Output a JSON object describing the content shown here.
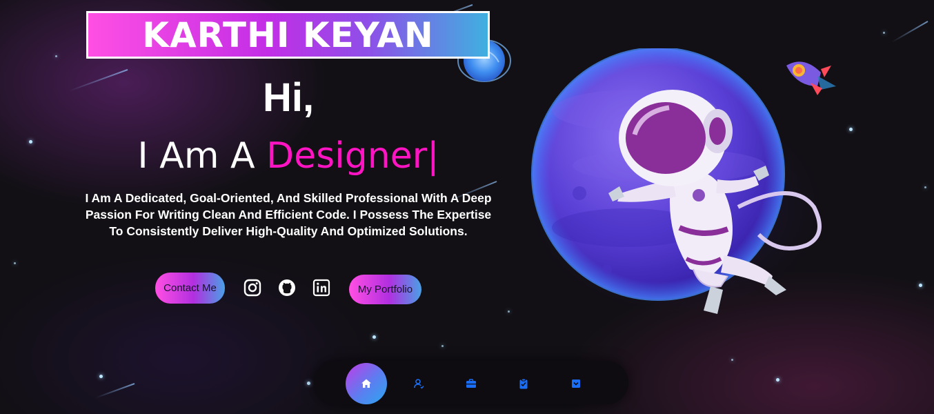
{
  "header": {
    "name": "KARTHI KEYAN"
  },
  "hero": {
    "greeting": "Hi,",
    "role_prefix": "I Am A ",
    "role_word": "Designer",
    "caret": "|",
    "description": "I Am A Dedicated, Goal-Oriented, And Skilled Professional With A Deep Passion For Writing Clean And Efficient Code. I Possess The Expertise To Consistently Deliver High-Quality And Optimized Solutions."
  },
  "actions": {
    "contact_label": "Contact Me",
    "portfolio_label": "My Portfolio"
  },
  "socials": [
    {
      "icon": "instagram-icon"
    },
    {
      "icon": "github-icon"
    },
    {
      "icon": "linkedin-icon"
    }
  ],
  "dock": {
    "items": [
      {
        "icon": "home-icon",
        "active": true
      },
      {
        "icon": "user-icon"
      },
      {
        "icon": "briefcase-icon"
      },
      {
        "icon": "clipboard-icon"
      },
      {
        "icon": "chevron-down-square-icon"
      }
    ]
  },
  "colors": {
    "accent_pink": "#ff14c4",
    "gradient_start": "#ff4fe3",
    "gradient_end": "#3fb0e0",
    "dock_icon_blue": "#1a6ef5"
  }
}
